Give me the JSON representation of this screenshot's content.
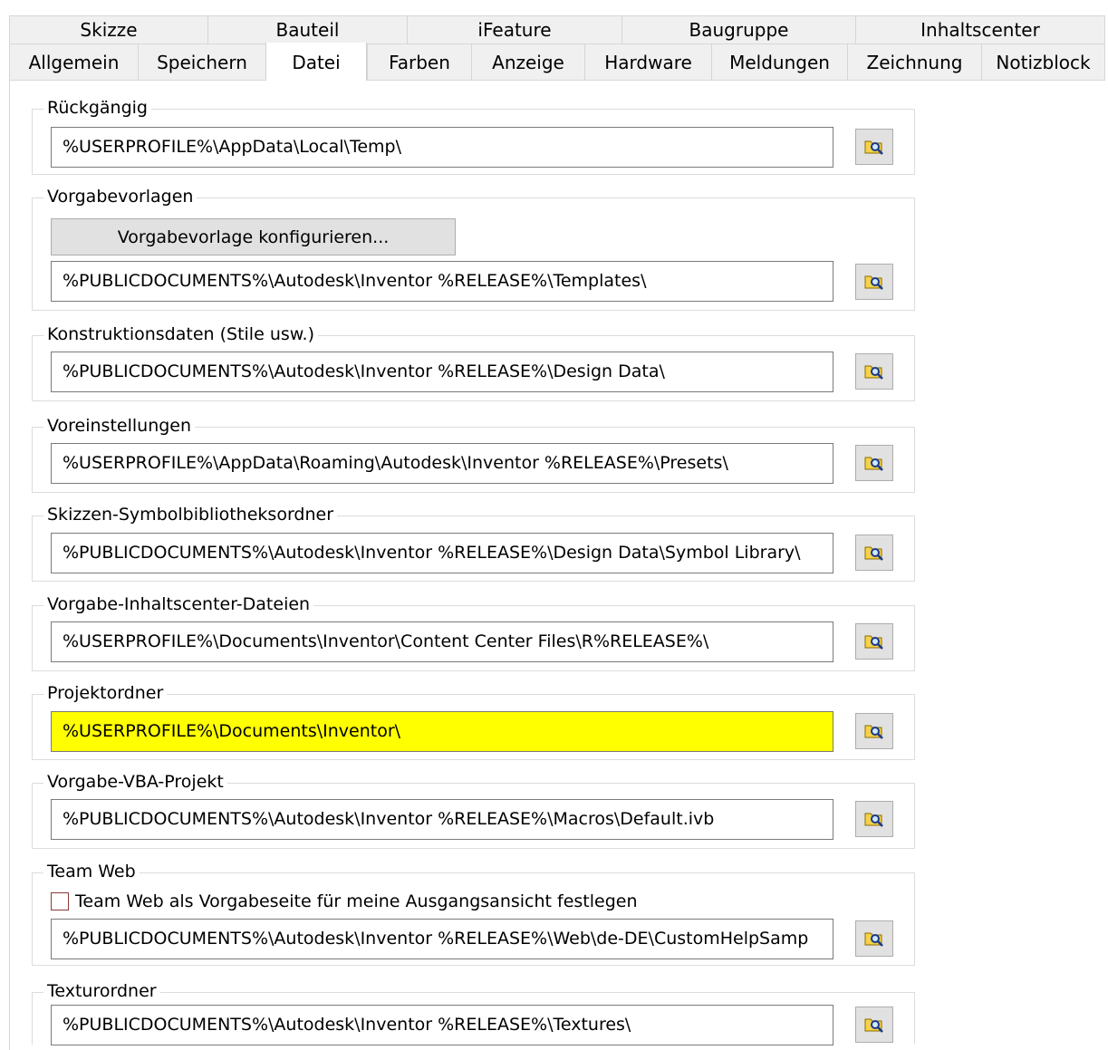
{
  "tabs": {
    "top": [
      "Skizze",
      "Bauteil",
      "iFeature",
      "Baugruppe",
      "Inhaltscenter"
    ],
    "bottom": [
      "Allgemein",
      "Speichern",
      "Datei",
      "Farben",
      "Anzeige",
      "Hardware",
      "Meldungen",
      "Zeichnung",
      "Notizblock"
    ],
    "active": "Datei"
  },
  "groups": {
    "undo": {
      "label": "Rückgängig",
      "path": "%USERPROFILE%\\AppData\\Local\\Temp\\"
    },
    "templates": {
      "label": "Vorgabevorlagen",
      "button": "Vorgabevorlage konfigurieren...",
      "path": "%PUBLICDOCUMENTS%\\Autodesk\\Inventor %RELEASE%\\Templates\\"
    },
    "design_data": {
      "label": "Konstruktionsdaten (Stile usw.)",
      "path": "%PUBLICDOCUMENTS%\\Autodesk\\Inventor %RELEASE%\\Design Data\\"
    },
    "presets": {
      "label": "Voreinstellungen",
      "path": "%USERPROFILE%\\AppData\\Roaming\\Autodesk\\Inventor %RELEASE%\\Presets\\"
    },
    "symbol_library": {
      "label": "Skizzen-Symbolbibliotheksordner",
      "path": "%PUBLICDOCUMENTS%\\Autodesk\\Inventor %RELEASE%\\Design Data\\Symbol Library\\"
    },
    "content_center": {
      "label": "Vorgabe-Inhaltscenter-Dateien",
      "path": "%USERPROFILE%\\Documents\\Inventor\\Content Center Files\\R%RELEASE%\\"
    },
    "project": {
      "label": "Projektordner",
      "path": "%USERPROFILE%\\Documents\\Inventor\\",
      "highlight_color": "#ffff00"
    },
    "vba": {
      "label": "Vorgabe-VBA-Projekt",
      "path": "%PUBLICDOCUMENTS%\\Autodesk\\Inventor %RELEASE%\\Macros\\Default.ivb"
    },
    "team_web": {
      "label": "Team Web",
      "checkbox_label": "Team Web als Vorgabeseite für meine Ausgangsansicht festlegen",
      "checked": false,
      "path": "%PUBLICDOCUMENTS%\\Autodesk\\Inventor %RELEASE%\\Web\\de-DE\\CustomHelpSamp"
    },
    "textures": {
      "label": "Texturordner",
      "path": "%PUBLICDOCUMENTS%\\Autodesk\\Inventor %RELEASE%\\Textures\\"
    }
  },
  "icons": {
    "browse": "browse-folder-icon"
  }
}
